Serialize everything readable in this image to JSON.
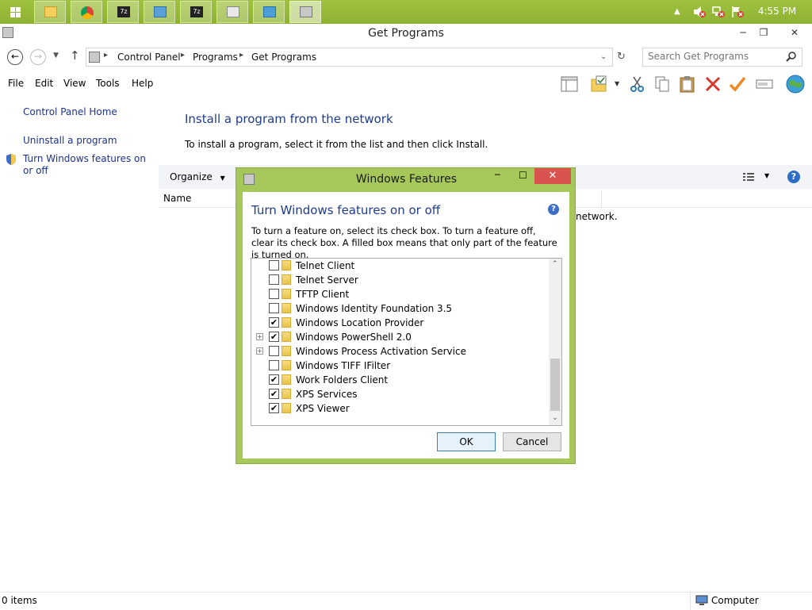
{
  "taskbar": {
    "clock": "4:55 PM",
    "buttons": [
      {
        "icon": "file-explorer-icon"
      },
      {
        "icon": "chrome-icon"
      },
      {
        "icon": "7zip-icon"
      },
      {
        "icon": "remote-desktop-icon"
      },
      {
        "icon": "7zip-icon"
      },
      {
        "icon": "mail-icon"
      },
      {
        "icon": "network-icon"
      },
      {
        "icon": "control-panel-icon"
      }
    ]
  },
  "window": {
    "title": "Get Programs"
  },
  "address": {
    "crumbs": [
      "Control Panel",
      "Programs",
      "Get Programs"
    ],
    "search_placeholder": "Search Get Programs"
  },
  "menu": {
    "items": [
      "File",
      "Edit",
      "View",
      "Tools",
      "Help"
    ]
  },
  "left_nav": {
    "home": "Control Panel Home",
    "uninstall": "Uninstall a program",
    "features": "Turn Windows features on or off"
  },
  "main": {
    "title": "Install a program from the network",
    "description": "To install a program, select it from the list and then click Install.",
    "organize_label": "Organize",
    "column_name": "Name",
    "network_msg": "network."
  },
  "status": {
    "items": "0 items",
    "computer": "Computer"
  },
  "dialog": {
    "title": "Windows Features",
    "heading": "Turn Windows features on or off",
    "description": "To turn a feature on, select its check box. To turn a feature off, clear its check box. A filled box means that only part of the feature is turned on.",
    "features": [
      {
        "label": "Telnet Client",
        "checked": false,
        "expandable": false
      },
      {
        "label": "Telnet Server",
        "checked": false,
        "expandable": false
      },
      {
        "label": "TFTP Client",
        "checked": false,
        "expandable": false
      },
      {
        "label": "Windows Identity Foundation 3.5",
        "checked": false,
        "expandable": false
      },
      {
        "label": "Windows Location Provider",
        "checked": true,
        "expandable": false
      },
      {
        "label": "Windows PowerShell 2.0",
        "checked": true,
        "expandable": true
      },
      {
        "label": "Windows Process Activation Service",
        "checked": false,
        "expandable": true
      },
      {
        "label": "Windows TIFF IFilter",
        "checked": false,
        "expandable": false
      },
      {
        "label": "Work Folders Client",
        "checked": true,
        "expandable": false
      },
      {
        "label": "XPS Services",
        "checked": true,
        "expandable": false
      },
      {
        "label": "XPS Viewer",
        "checked": true,
        "expandable": false
      }
    ],
    "ok_label": "OK",
    "cancel_label": "Cancel"
  }
}
